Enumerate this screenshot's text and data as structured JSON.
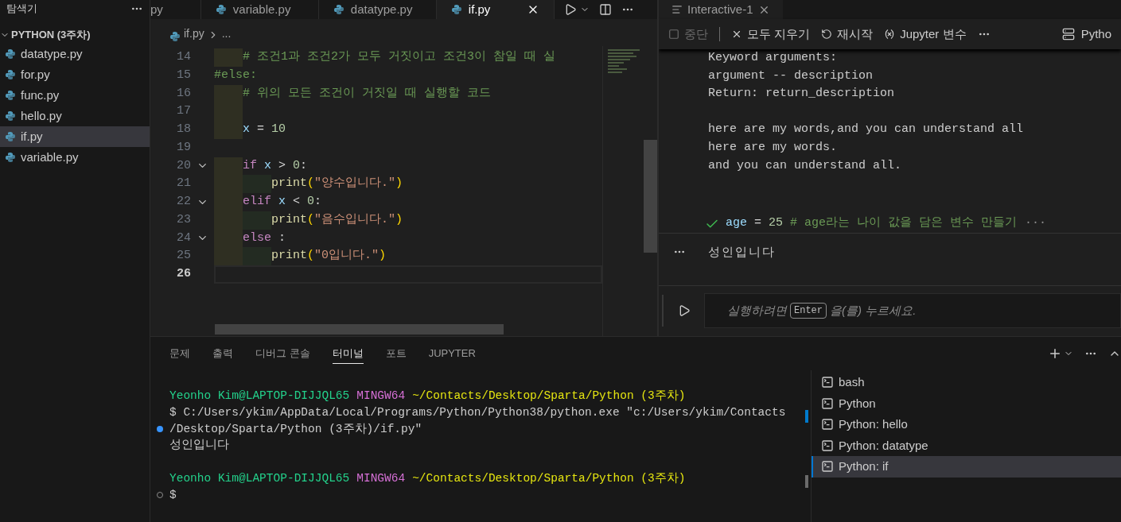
{
  "sidebar": {
    "title": "탐색기",
    "folder": {
      "label": "PYTHON (3주차)",
      "expanded": true
    },
    "files": [
      {
        "label": "datatype.py",
        "selected": false
      },
      {
        "label": "for.py",
        "selected": false
      },
      {
        "label": "func.py",
        "selected": false
      },
      {
        "label": "hello.py",
        "selected": false
      },
      {
        "label": "if.py",
        "selected": true
      },
      {
        "label": "variable.py",
        "selected": false
      }
    ]
  },
  "editor": {
    "tabs": [
      {
        "label": "py",
        "selected": false,
        "kind": "clipped"
      },
      {
        "label": "variable.py",
        "selected": false,
        "kind": "file"
      },
      {
        "label": "datatype.py",
        "selected": false,
        "kind": "file"
      },
      {
        "label": "if.py",
        "selected": true,
        "kind": "file"
      }
    ],
    "breadcrumb": {
      "file": "if.py",
      "rest": "..."
    },
    "code": [
      {
        "children": [
          {
            "number": "14",
            "foldable": false,
            "current": false,
            "segments": [
              {
                "kind": "comment",
                "text": "# 조건1과 조건2가 모두 거짓이고 조건3이 참일 때 실"
              }
            ]
          }
        ]
      },
      {
        "number": "15",
        "foldable": false,
        "current": false,
        "segments": [
          {
            "kind": "comment",
            "text": "#else:"
          }
        ]
      },
      {
        "children": [
          {
            "number": "16",
            "foldable": false,
            "current": false,
            "segments": [
              {
                "kind": "comment",
                "text": "# 위의 모든 조건이 거짓일 때 실행할 코드"
              }
            ]
          },
          {
            "number": "17",
            "foldable": false,
            "current": false
          },
          {
            "number": "18",
            "foldable": false,
            "current": false,
            "segments": [
              {
                "kind": "var",
                "text": "x"
              },
              {
                "kind": "op",
                "text": " = "
              },
              {
                "kind": "num",
                "text": "10"
              }
            ]
          }
        ]
      },
      {
        "number": "19",
        "foldable": false,
        "current": false
      },
      {
        "children": [
          {
            "number": "20",
            "foldable": true,
            "current": false,
            "segments": [
              {
                "kind": "keyword",
                "text": "if"
              },
              {
                "kind": "var",
                "text": "x"
              },
              {
                "kind": "op",
                "text": " > "
              },
              {
                "kind": "num",
                "text": "0"
              },
              {
                "kind": "op",
                "text": ":"
              }
            ]
          },
          {
            "children": [
              {
                "number": "21",
                "foldable": false,
                "current": false,
                "segments": [
                  {
                    "kind": "func",
                    "text": "print"
                  },
                  {
                    "kind": "paren",
                    "text": "("
                  },
                  {
                    "kind": "string",
                    "text": "\"양수입니다.\""
                  },
                  {
                    "kind": "paren",
                    "text": ")"
                  }
                ]
              }
            ]
          },
          {
            "number": "22",
            "foldable": true,
            "current": false,
            "segments": [
              {
                "kind": "keyword",
                "text": "elif"
              },
              {
                "kind": "var",
                "text": "x"
              },
              {
                "kind": "op",
                "text": " < "
              },
              {
                "kind": "num",
                "text": "0"
              },
              {
                "kind": "op",
                "text": ":"
              }
            ]
          },
          {
            "children": [
              {
                "number": "23",
                "foldable": false,
                "current": false,
                "segments": [
                  {
                    "kind": "func",
                    "text": "print"
                  },
                  {
                    "kind": "paren",
                    "text": "("
                  },
                  {
                    "kind": "string",
                    "text": "\"음수입니다.\""
                  },
                  {
                    "kind": "paren",
                    "text": ")"
                  }
                ]
              }
            ]
          },
          {
            "number": "24",
            "foldable": true,
            "current": false,
            "segments": [
              {
                "kind": "keyword",
                "text": "else"
              },
              {
                "kind": "op",
                "text": ":"
              }
            ]
          },
          {
            "children": [
              {
                "number": "25",
                "foldable": false,
                "current": false,
                "segments": [
                  {
                    "kind": "func",
                    "text": "print"
                  },
                  {
                    "kind": "paren",
                    "text": "("
                  },
                  {
                    "kind": "string",
                    "text": "\"0입니다.\""
                  },
                  {
                    "kind": "paren",
                    "text": ")"
                  }
                ]
              }
            ]
          }
        ]
      },
      {
        "number": "26",
        "foldable": false,
        "current": true
      }
    ]
  },
  "interactive": {
    "tab": "Interactive-1",
    "toolbar": [
      {
        "kind": "stop",
        "label": "중단",
        "disabled": true
      },
      {
        "kind": "clear",
        "label": "모두 지우기",
        "disabled": false
      },
      {
        "kind": "restart",
        "label": "재시작",
        "disabled": false
      },
      {
        "kind": "variables",
        "label": "Jupyter 변수",
        "disabled": false
      }
    ],
    "kernel": "Pytho",
    "output": [
      [
        "Keyword arguments:",
        "argument -- description",
        "Return: return_description"
      ],
      [
        "here are my words,and you can understand all",
        "here are my words.",
        "and you can understand all."
      ]
    ],
    "cell": {
      "succeeded": true,
      "segments": [
        {
          "kind": "var",
          "text": "age"
        },
        {
          "kind": "op",
          "text": " = "
        },
        {
          "kind": "num",
          "text": "25"
        },
        {
          "kind": "comment",
          "text": " # age라는 나이 값을 담은 변수 만들기"
        },
        {
          "kind": "more",
          "text": "···"
        }
      ],
      "output": "성인입니다"
    },
    "input": {
      "before": "실행하려면",
      "key": "Enter",
      "after": "을(를) 누르세요."
    }
  },
  "panel": {
    "tabs": [
      {
        "label": "문제",
        "selected": false
      },
      {
        "label": "출력",
        "selected": false
      },
      {
        "label": "디버그 콘솔",
        "selected": false
      },
      {
        "label": "터미널",
        "selected": true
      },
      {
        "label": "포트",
        "selected": false
      },
      {
        "label": "JUPYTER",
        "selected": false
      }
    ],
    "terminal": [
      {
        "kind": "plain",
        "segments": [
          {
            "kind": "user",
            "text": "Yeonho Kim@LAPTOP-DIJJQL65"
          },
          {
            "kind": "shell",
            "text": "MINGW64"
          },
          {
            "kind": "path",
            "text": "~/Contacts/Desktop/Sparta/Python (3주차)"
          }
        ]
      },
      {
        "kind": "plain",
        "segments": [
          {
            "kind": "plain",
            "text": "$ C:/Users/ykim/AppData/Local/Programs/Python/Python38/python.exe \"c:/Users/ykim/Contacts"
          }
        ]
      },
      {
        "kind": "success",
        "segments": [
          {
            "kind": "plain",
            "text": "/Desktop/Sparta/Python (3주차)/if.py\""
          }
        ]
      },
      {
        "kind": "plain",
        "segments": [
          {
            "kind": "plain",
            "text": "성인입니다"
          }
        ]
      },
      {
        "kind": "blank"
      },
      {
        "kind": "plain",
        "segments": [
          {
            "kind": "user",
            "text": "Yeonho Kim@LAPTOP-DIJJQL65"
          },
          {
            "kind": "shell",
            "text": "MINGW64"
          },
          {
            "kind": "path",
            "text": "~/Contacts/Desktop/Sparta/Python (3주차)"
          }
        ]
      },
      {
        "kind": "pending",
        "segments": [
          {
            "kind": "plain",
            "text": "$"
          }
        ]
      }
    ],
    "terminals": [
      {
        "label": "bash",
        "selected": false
      },
      {
        "label": "Python",
        "selected": false
      },
      {
        "label": "Python: hello",
        "selected": false
      },
      {
        "label": "Python: datatype",
        "selected": false
      },
      {
        "label": "Python: if",
        "selected": true
      }
    ]
  }
}
